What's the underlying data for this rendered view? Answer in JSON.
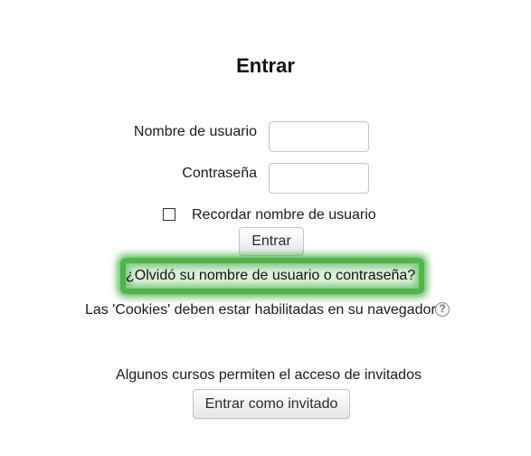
{
  "page": {
    "title": "Entrar"
  },
  "login_form": {
    "username_label": "Nombre de usuario",
    "username_value": "",
    "password_label": "Contraseña",
    "password_value": "",
    "remember_label": "Recordar nombre de usuario",
    "remember_checked": false,
    "submit_label": "Entrar"
  },
  "forgot": {
    "link_text": "¿Olvidó su nombre de usuario o contraseña?",
    "highlight_color": "#4fb54a"
  },
  "cookies_notice": {
    "text": "Las 'Cookies' deben estar habilitadas en su navegador",
    "help_icon": "help-circle-icon",
    "help_glyph": "?"
  },
  "guest": {
    "info_text": "Algunos cursos permiten el acceso de invitados",
    "button_label": "Entrar como invitado"
  }
}
